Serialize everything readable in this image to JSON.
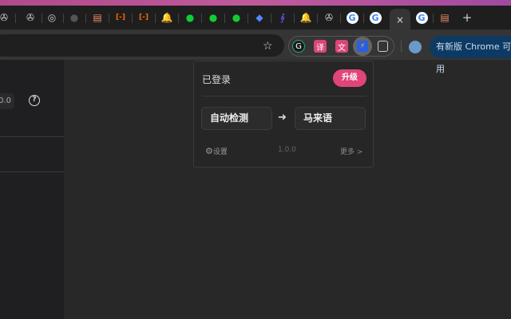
{
  "tabs": [
    {
      "icon": "mercedes-icon",
      "glyph": "✇",
      "color": "#ccc"
    },
    {
      "icon": "mercedes-icon",
      "glyph": "✇",
      "color": "#ccc"
    },
    {
      "icon": "chrome-icon",
      "glyph": "◎",
      "color": "#ccc"
    },
    {
      "icon": "globe-icon",
      "glyph": "●",
      "color": "#555"
    },
    {
      "icon": "google-doc-icon",
      "glyph": "▤",
      "color": "#e86"
    },
    {
      "icon": "aliyun-icon",
      "glyph": "[-]",
      "color": "#f60"
    },
    {
      "icon": "aliyun-icon",
      "glyph": "[-]",
      "color": "#f60"
    },
    {
      "icon": "bell-icon",
      "glyph": "🔔",
      "color": "#48f"
    },
    {
      "icon": "wechat-icon",
      "glyph": "●",
      "color": "#1c3"
    },
    {
      "icon": "wechat-icon",
      "glyph": "●",
      "color": "#1c3"
    },
    {
      "icon": "wechat-icon",
      "glyph": "●",
      "color": "#1c3"
    },
    {
      "icon": "diamond-icon",
      "glyph": "◆",
      "color": "#58f"
    },
    {
      "icon": "link-icon",
      "glyph": "∮",
      "color": "#75f"
    },
    {
      "icon": "bell-icon",
      "glyph": "🔔",
      "color": "#48f"
    },
    {
      "icon": "mercedes-icon",
      "glyph": "✇",
      "color": "#ccc"
    },
    {
      "icon": "google-icon",
      "glyph": "G",
      "color": "#4285f4"
    },
    {
      "icon": "google-icon",
      "glyph": "G",
      "color": "#4285f4"
    },
    {
      "icon": "google-icon",
      "glyph": "G",
      "color": "#4285f4"
    },
    {
      "icon": "google-doc-icon",
      "glyph": "▤",
      "color": "#e86"
    }
  ],
  "active_tab_close": "×",
  "new_tab": "+",
  "update_button": "有新版 Chrome 可用",
  "left_panel": {
    "version": "0.0",
    "help": "?"
  },
  "popup": {
    "status": "已登录",
    "upgrade": "升级",
    "source_lang": "自动检测",
    "target_lang": "马来语",
    "arrow": "➜",
    "settings": "设置",
    "version": "1.0.0",
    "more": "更多 >"
  }
}
